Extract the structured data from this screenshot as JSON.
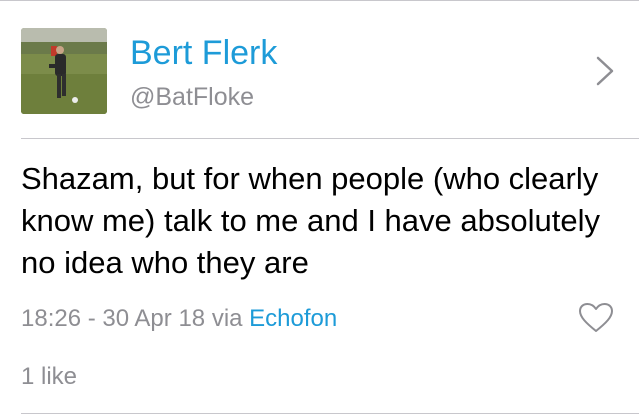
{
  "profile": {
    "display_name": "Bert Flerk",
    "handle": "@BatFloke",
    "avatar_icon": "profile-photo",
    "chevron_icon": "chevron-right-icon"
  },
  "tweet": {
    "text": "Shazam, but for when people (who clearly know me) talk to me and I have absolutely no idea who they are",
    "timestamp": "18:26 - 30 Apr 18",
    "via_label": "via",
    "via_app": "Echofon",
    "like_icon": "heart-icon"
  },
  "stats": {
    "likes_text": "1 like"
  },
  "colors": {
    "accent": "#1d9bd8",
    "secondary_text": "#8e8e93",
    "divider": "#c8c7cc"
  }
}
